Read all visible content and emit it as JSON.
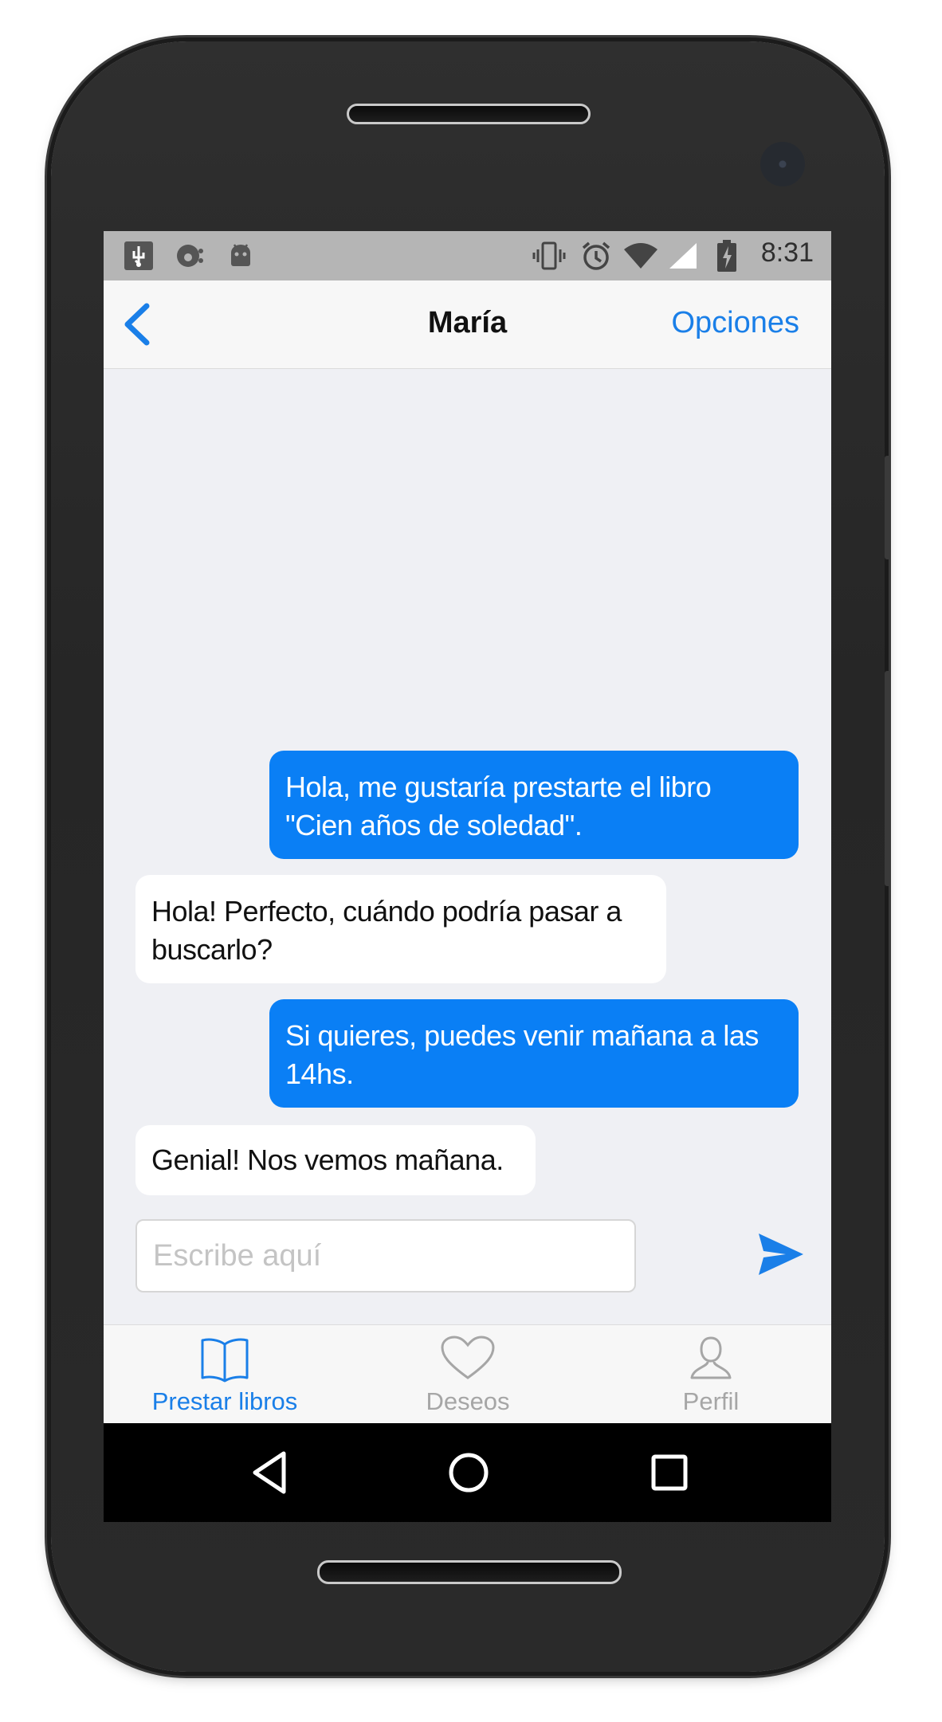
{
  "status_bar": {
    "time": "8:31",
    "left_icons": [
      "usb-icon",
      "debug-icon",
      "android-icon"
    ],
    "right_icons": [
      "vibrate-icon",
      "alarm-icon",
      "wifi-icon",
      "signal-icon",
      "battery-icon"
    ]
  },
  "header": {
    "title": "María",
    "options_label": "Opciones"
  },
  "messages": [
    {
      "direction": "outgoing",
      "lines": [
        "Hola, me gustaría prestarte el libro",
        "\"Cien años de soledad\"."
      ]
    },
    {
      "direction": "incoming",
      "lines": [
        "Hola! Perfecto, cuándo podría pasar a",
        "buscarlo?"
      ]
    },
    {
      "direction": "outgoing",
      "lines": [
        "Si quieres, puedes venir mañana a las",
        "14hs."
      ]
    },
    {
      "direction": "incoming",
      "lines": [
        "Genial! Nos vemos mañana."
      ]
    }
  ],
  "composer": {
    "placeholder": "Escribe aquí",
    "value": ""
  },
  "tabs": [
    {
      "label": "Prestar libros",
      "icon": "book-icon",
      "active": true
    },
    {
      "label": "Deseos",
      "icon": "heart-icon",
      "active": false
    },
    {
      "label": "Perfil",
      "icon": "profile-icon",
      "active": false
    }
  ],
  "colors": {
    "accent": "#1a7fe8",
    "outgoing_bubble": "#0a7ff5",
    "incoming_bubble": "#ffffff",
    "inactive_tab": "#a6a6a6"
  }
}
